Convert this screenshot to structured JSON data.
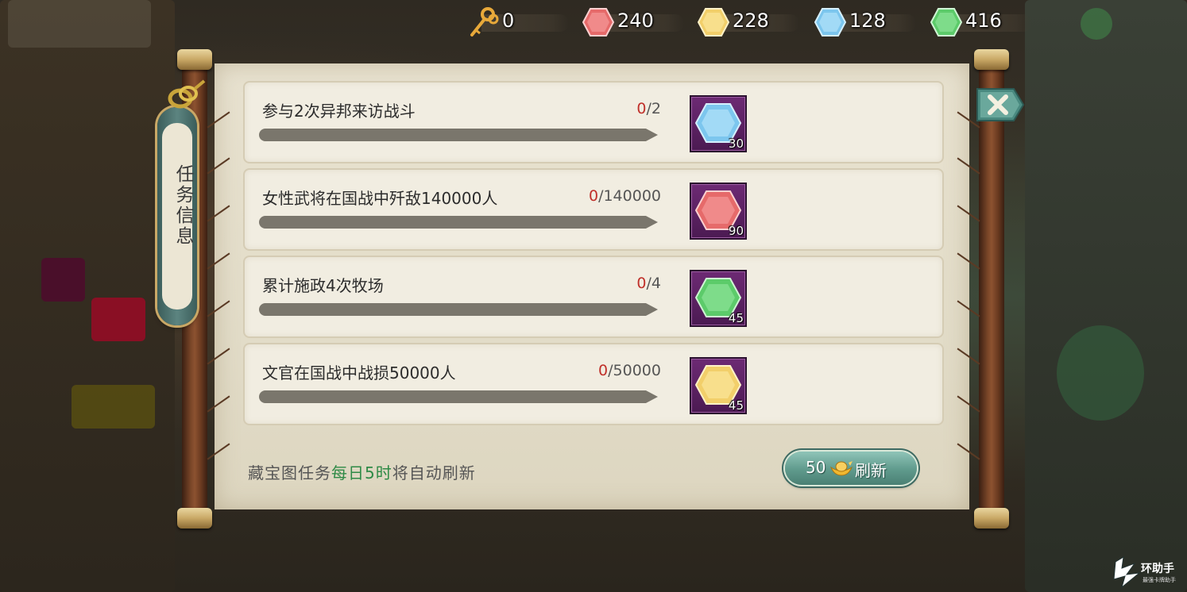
{
  "currencies": [
    {
      "name": "key",
      "value": "0",
      "color": "#e8a93a"
    },
    {
      "name": "red-gem",
      "value": "240",
      "color": "#e66a6a"
    },
    {
      "name": "yellow-gem",
      "value": "228",
      "color": "#f2cf6a"
    },
    {
      "name": "blue-gem",
      "value": "128",
      "color": "#7cc6ee"
    },
    {
      "name": "green-gem",
      "value": "416",
      "color": "#5ccb6a"
    }
  ],
  "side_title": "任务信息",
  "tasks": [
    {
      "name": "参与2次异邦来访战斗",
      "current": "0",
      "separator": "/",
      "total": "2",
      "progress": 0,
      "reward_gem": "blue-gem",
      "reward_color": "#7cc6ee",
      "reward_qty": "30"
    },
    {
      "name": "女性武将在国战中歼敌140000人",
      "current": "0",
      "separator": "/",
      "total": "140000",
      "progress": 0,
      "reward_gem": "red-gem",
      "reward_color": "#e66a6a",
      "reward_qty": "90"
    },
    {
      "name": "累计施政4次牧场",
      "current": "0",
      "separator": "/",
      "total": "4",
      "progress": 0,
      "reward_gem": "green-gem",
      "reward_color": "#5ccb6a",
      "reward_qty": "45"
    },
    {
      "name": "文官在国战中战损50000人",
      "current": "0",
      "separator": "/",
      "total": "50000",
      "progress": 0,
      "reward_gem": "yellow-gem",
      "reward_color": "#f2cf6a",
      "reward_qty": "45"
    }
  ],
  "footer": {
    "prefix": "藏宝图任务",
    "highlight": "每日5时",
    "suffix": "将自动刷新"
  },
  "refresh": {
    "cost": "50",
    "label": "刷新",
    "icon": "gold-ingot-icon"
  },
  "close_icon": "close-icon",
  "watermark": {
    "text": "环助手",
    "sub": "最强卡牌助手"
  }
}
